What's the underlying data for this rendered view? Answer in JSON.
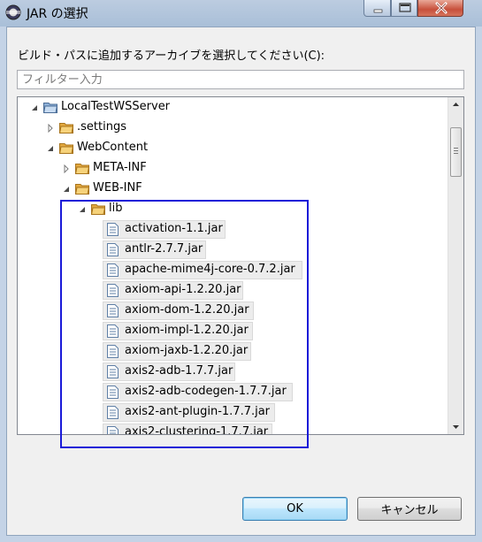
{
  "window": {
    "title": "JAR の選択"
  },
  "dialog": {
    "prompt": "ビルド・パスに追加するアーカイブを選択してください(C):",
    "filter_placeholder": "フィルター入力"
  },
  "tree": {
    "project": "LocalTestWSServer",
    "settings": ".settings",
    "webcontent": "WebContent",
    "metainf": "META-INF",
    "webinf": "WEB-INF",
    "lib": "lib",
    "files": [
      "activation-1.1.jar",
      "antlr-2.7.7.jar",
      "apache-mime4j-core-0.7.2.jar",
      "axiom-api-1.2.20.jar",
      "axiom-dom-1.2.20.jar",
      "axiom-impl-1.2.20.jar",
      "axiom-jaxb-1.2.20.jar",
      "axis2-adb-1.7.7.jar",
      "axis2-adb-codegen-1.7.7.jar",
      "axis2-ant-plugin-1.7.7.jar",
      "axis2-clustering-1.7.7.jar"
    ]
  },
  "buttons": {
    "ok": "OK",
    "cancel": "キャンセル"
  },
  "colors": {
    "highlight": "#1a1ad8",
    "folder": "#e8b04a",
    "titlebar": "#a9bfd8"
  }
}
